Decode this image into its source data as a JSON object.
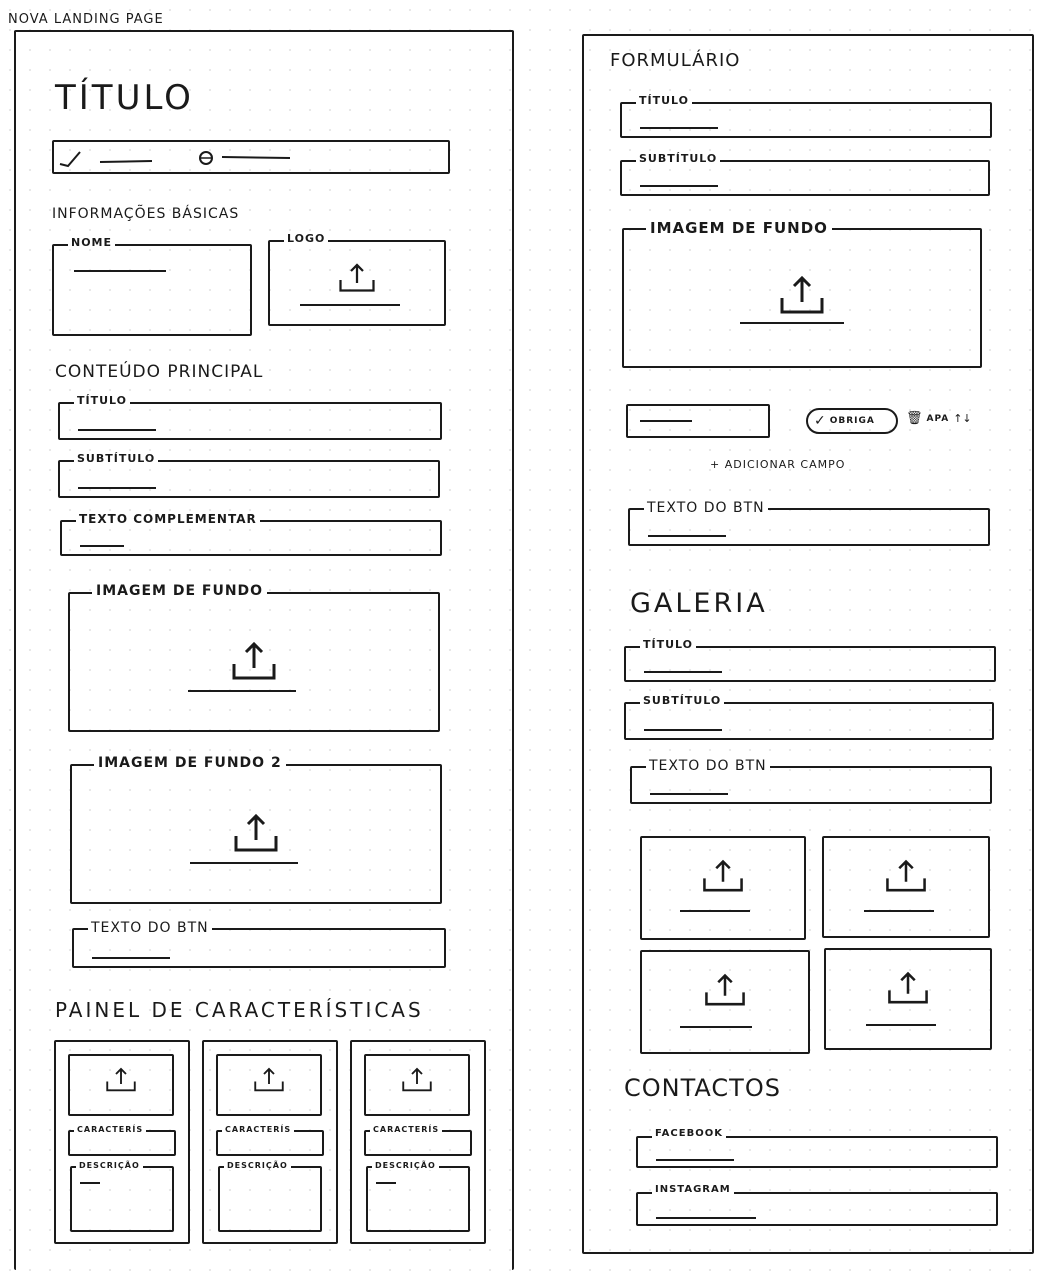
{
  "page": {
    "title": "NOVA LANDING PAGE"
  },
  "left": {
    "title": "TÍTULO",
    "progress": {
      "step_done": true,
      "step_current": 2
    },
    "basic_info": {
      "heading": "INFORMAÇÕES BÁSICAS",
      "name_label": "NOME",
      "logo_label": "LOGO"
    },
    "main_content": {
      "heading": "CONTEÚDO PRINCIPAL",
      "title_label": "TÍTULO",
      "subtitle_label": "SUBTÍTULO",
      "complementary_label": "TEXTO COMPLEMENTAR",
      "bg_image_label": "IMAGEM DE FUNDO",
      "bg_image2_label": "IMAGEM DE FUNDO 2",
      "button_text_label": "TEXTO DO BTN"
    },
    "features": {
      "heading": "PAINEL DE CARACTERÍSTICAS",
      "cards": [
        {
          "feature_label": "CARACTERÍS",
          "description_label": "DESCRIÇÃO"
        },
        {
          "feature_label": "CARACTERÍS",
          "description_label": "DESCRIÇÃO"
        },
        {
          "feature_label": "CARACTERÍS",
          "description_label": "DESCRIÇÃO"
        }
      ]
    }
  },
  "right": {
    "form": {
      "heading": "FORMULÁRIO",
      "title_label": "TÍTULO",
      "subtitle_label": "SUBTÍTULO",
      "bg_image_label": "IMAGEM DE FUNDO",
      "required_label": "OBRIGA",
      "delete_label": "APA",
      "add_field": "+ ADICIONAR CAMPO",
      "button_text_label": "TEXTO DO BTN"
    },
    "gallery": {
      "heading": "GALERIA",
      "title_label": "TÍTULO",
      "subtitle_label": "SUBTÍTULO",
      "button_text_label": "TEXTO DO BTN"
    },
    "contacts": {
      "heading": "CONTACTOS",
      "facebook_label": "FACEBOOK",
      "instagram_label": "INSTAGRAM"
    }
  }
}
